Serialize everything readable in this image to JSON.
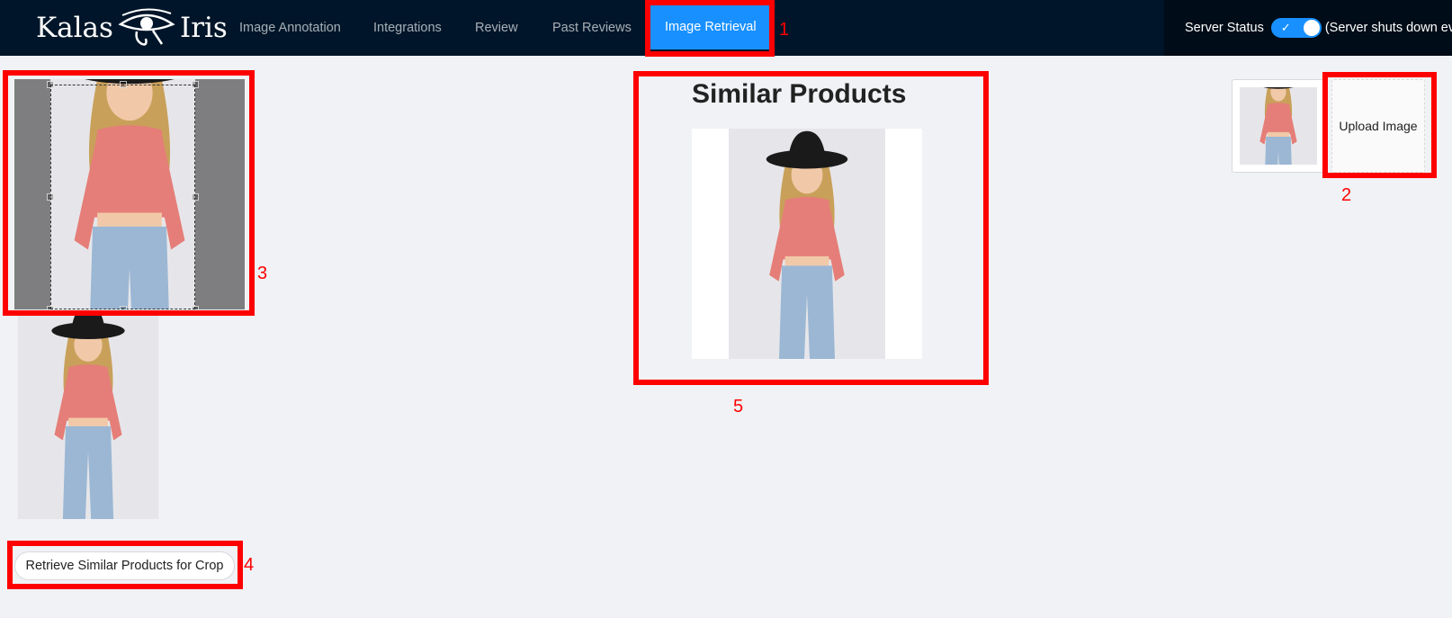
{
  "header": {
    "logo_left": "Kalas",
    "logo_right": "Iris",
    "nav": [
      {
        "label": "Image Annotation",
        "active": false
      },
      {
        "label": "Integrations",
        "active": false
      },
      {
        "label": "Review",
        "active": false
      },
      {
        "label": "Past Reviews",
        "active": false
      },
      {
        "label": "Image Retrieval",
        "active": true
      }
    ],
    "server_status_label": "Server Status",
    "server_status_on": true,
    "server_status_note": "(Server shuts down every night)"
  },
  "crop": {
    "retrieve_button_label": "Retrieve Similar Products for Crop"
  },
  "results": {
    "title": "Similar Products"
  },
  "upload": {
    "upload_label": "Upload Image"
  },
  "annotations": [
    "1",
    "2",
    "3",
    "4",
    "5"
  ],
  "colors": {
    "header_bg": "#001529",
    "active_tab": "#1890ff",
    "highlight": "#ff0000",
    "page_bg": "#f0f2f5"
  }
}
